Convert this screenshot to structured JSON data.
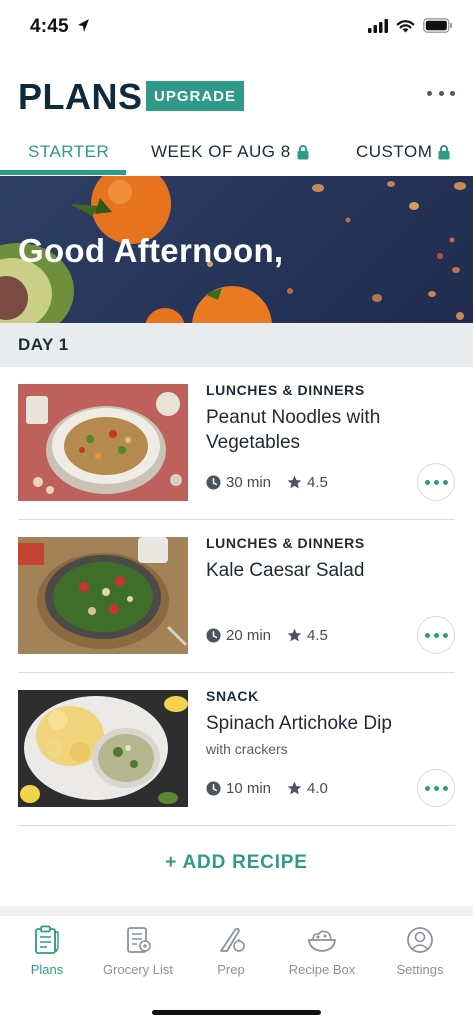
{
  "status_bar": {
    "time": "4:45"
  },
  "header": {
    "title": "PLANS",
    "upgrade_label": "UPGRADE"
  },
  "tabs": [
    {
      "label": "STARTER",
      "locked": false
    },
    {
      "label": "WEEK OF AUG 8",
      "locked": true
    },
    {
      "label": "CUSTOM",
      "locked": true
    }
  ],
  "banner": {
    "greeting": "Good Afternoon,"
  },
  "day": {
    "label": "DAY 1"
  },
  "recipes": [
    {
      "category": "LUNCHES & DINNERS",
      "name": "Peanut Noodles with Vegetables",
      "subtitle": "",
      "time": "30 min",
      "rating": "4.5"
    },
    {
      "category": "LUNCHES & DINNERS",
      "name": "Kale Caesar Salad",
      "subtitle": "",
      "time": "20 min",
      "rating": "4.5"
    },
    {
      "category": "SNACK",
      "name": "Spinach Artichoke Dip",
      "subtitle": "with crackers",
      "time": "10 min",
      "rating": "4.0"
    }
  ],
  "add_recipe": {
    "label": "+ ADD RECIPE"
  },
  "bottom_nav": [
    {
      "label": "Plans",
      "icon": "plans-icon",
      "active": true
    },
    {
      "label": "Grocery List",
      "icon": "grocery-list-icon",
      "active": false
    },
    {
      "label": "Prep",
      "icon": "prep-icon",
      "active": false
    },
    {
      "label": "Recipe Box",
      "icon": "recipe-box-icon",
      "active": false
    },
    {
      "label": "Settings",
      "icon": "settings-icon",
      "active": false
    }
  ],
  "colors": {
    "accent": "#2f9a88",
    "title": "#0f2a3d",
    "banner": "#2f3f63"
  }
}
